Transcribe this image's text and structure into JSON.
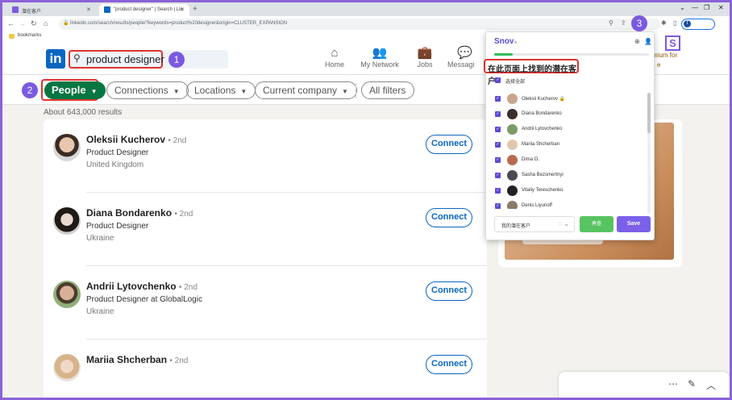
{
  "browser": {
    "tabs": [
      {
        "label": "潜在客户",
        "favicon_color": "#7a5ae0"
      },
      {
        "label": "\"product designer\" | Search | Lin",
        "favicon_color": "#0a66c2"
      }
    ],
    "url": "linkedin.com/search/results/people/?keywords=product%20designer&origin=CLUSTER_EXPANSION",
    "bookmarks_label": "bookmarks",
    "profile_initial": "T"
  },
  "linkedin": {
    "logo": "in",
    "search_query": "product designer",
    "nav": [
      "Home",
      "My Network",
      "Jobs",
      "Messagi"
    ],
    "premium_text": "mium for",
    "premium_text2": "e",
    "filters": {
      "people": "People",
      "connections": "Connections",
      "locations": "Locations",
      "current_company": "Current company",
      "all_filters": "All filters"
    },
    "result_count": "About 643,000 results",
    "results": [
      {
        "name": "Oleksii Kucherov",
        "degree": "• 2nd",
        "title": "Product Designer",
        "location": "United Kingdom",
        "action": "Connect"
      },
      {
        "name": "Diana Bondarenko",
        "degree": "• 2nd",
        "title": "Product Designer",
        "location": "Ukraine",
        "action": "Connect"
      },
      {
        "name": "Andrii Lytovchenko",
        "degree": "• 2nd",
        "title": "Product Designer at GlobalLogic",
        "location": "Ukraine",
        "action": "Connect"
      },
      {
        "name": "Mariia Shcherban",
        "degree": "• 2nd",
        "title": "",
        "location": "",
        "action": "Connect"
      }
    ]
  },
  "annotations": {
    "step1": "1",
    "step2": "2",
    "step3": "3",
    "ext_letter": "S"
  },
  "snov": {
    "brand": "Snov",
    "brand_suffix": "io",
    "heading": "在此页面上找到的潜在客户",
    "select_all": "选择全部",
    "prospects": [
      "Oleksii Kucherov 🔒",
      "Diana Bondarenko",
      "Andrii Lytovchenko",
      "Mariia Shcherban",
      "Dima O.",
      "Sasha Bezsmertnyi",
      "Vitaliy Tereschenko",
      "Denis Liyunoff"
    ],
    "list_select": "我的潜在客户",
    "btn_secondary": "再查",
    "btn_save": "Save",
    "progress_percent": 12
  }
}
